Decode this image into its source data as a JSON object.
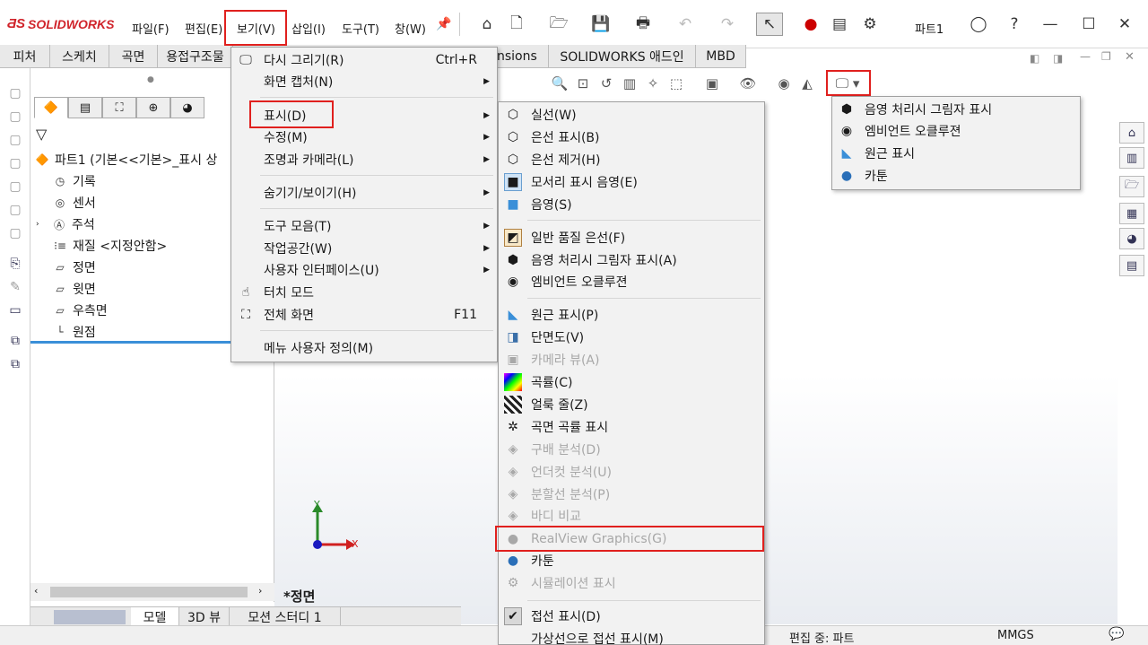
{
  "app": {
    "name": "SOLIDWORKS",
    "doc_title": "파트1"
  },
  "menubar": [
    "파일(F)",
    "편집(E)",
    "보기(V)",
    "삽입(I)",
    "도구(T)",
    "창(W)"
  ],
  "command_tabs": [
    "피처",
    "스케치",
    "곡면",
    "용접구조물",
    "nsions",
    "SOLIDWORKS 애드인",
    "MBD"
  ],
  "fm_tabs": [
    "feature-manager",
    "property-manager",
    "configuration-manager",
    "dimxpert",
    "display-manager"
  ],
  "tree": {
    "root": "파트1  (기본<<기본>_표시 상",
    "items": [
      "기록",
      "센서",
      "주석",
      "재질 <지정안함>",
      "정면",
      "윗면",
      "우측면",
      "원점"
    ]
  },
  "view_menu": {
    "items": [
      {
        "label": "다시 그리기(R)",
        "accel": "Ctrl+R"
      },
      {
        "label": "화면 캡처(N)"
      },
      {
        "label": "표시(D)"
      },
      {
        "label": "수정(M)"
      },
      {
        "label": "조명과 카메라(L)"
      },
      {
        "label": "숨기기/보이기(H)"
      },
      {
        "label": "도구 모음(T)"
      },
      {
        "label": "작업공간(W)"
      },
      {
        "label": "사용자 인터페이스(U)"
      },
      {
        "label": "터치 모드"
      },
      {
        "label": "전체 화면",
        "accel": "F11"
      },
      {
        "label": "메뉴 사용자 정의(M)"
      }
    ]
  },
  "display_menu": {
    "items": [
      "실선(W)",
      "은선 표시(B)",
      "은선 제거(H)",
      "모서리 표시 음영(E)",
      "음영(S)",
      "일반 품질 은선(F)",
      "음영 처리시 그림자 표시(A)",
      "엠비언트 오클루젼",
      "원근 표시(P)",
      "단면도(V)",
      "카메라 뷰(A)",
      "곡률(C)",
      "얼룩 줄(Z)",
      "곡면 곡률 표시",
      "구배 분석(D)",
      "언더컷 분석(U)",
      "분할선 분석(P)",
      "바디 비교",
      "RealView Graphics(G)",
      "카툰",
      "시뮬레이션 표시",
      "접선 표시(D)",
      "가상선으로 접선 표시(M)"
    ]
  },
  "toolbar_dropdown": {
    "items": [
      "음영 처리시 그림자 표시",
      "엠비언트 오클루젼",
      "원근 표시",
      "카툰"
    ]
  },
  "viewport": {
    "view_name": "*정면",
    "axis_x": "X",
    "axis_y": "Y"
  },
  "bottom_tabs": [
    "모델",
    "3D 뷰",
    "모션 스터디 1"
  ],
  "status": {
    "editing": "편집 중: 파트",
    "units": "MMGS"
  },
  "colors": {
    "highlight": "#e0201e",
    "brand": "#d0242b"
  }
}
